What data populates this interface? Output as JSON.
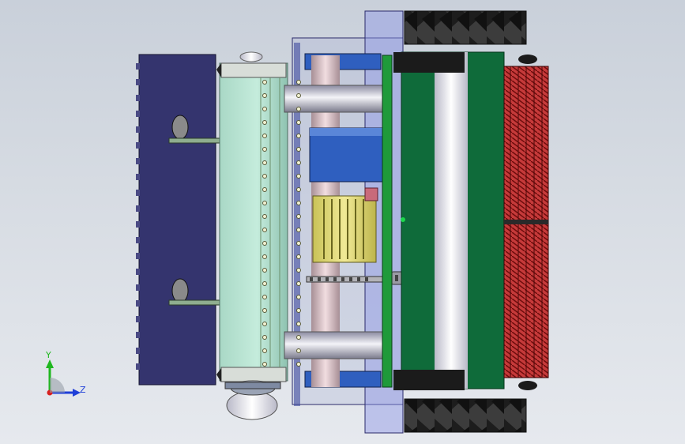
{
  "viewport": {
    "background_top": "#c9d0da",
    "background_bottom": "#e6e9ee"
  },
  "triad": {
    "y_label": "Y",
    "z_label": "Z",
    "y_color": "#1fb71f",
    "z_color": "#1f3fd8",
    "x_color": "#d81f1f"
  },
  "model": {
    "hopper_color": "#34346e",
    "roller_color": "#9fd0b8",
    "frame_color": "#cfd8dc",
    "gearbox_color": "#dcd56a",
    "motor_color": "#2f5fbf",
    "plate_color": "#0f6b3a",
    "brush_color": "#8a1212",
    "tire_color": "#2a2a2a",
    "glass_color": "#8c95e6"
  }
}
